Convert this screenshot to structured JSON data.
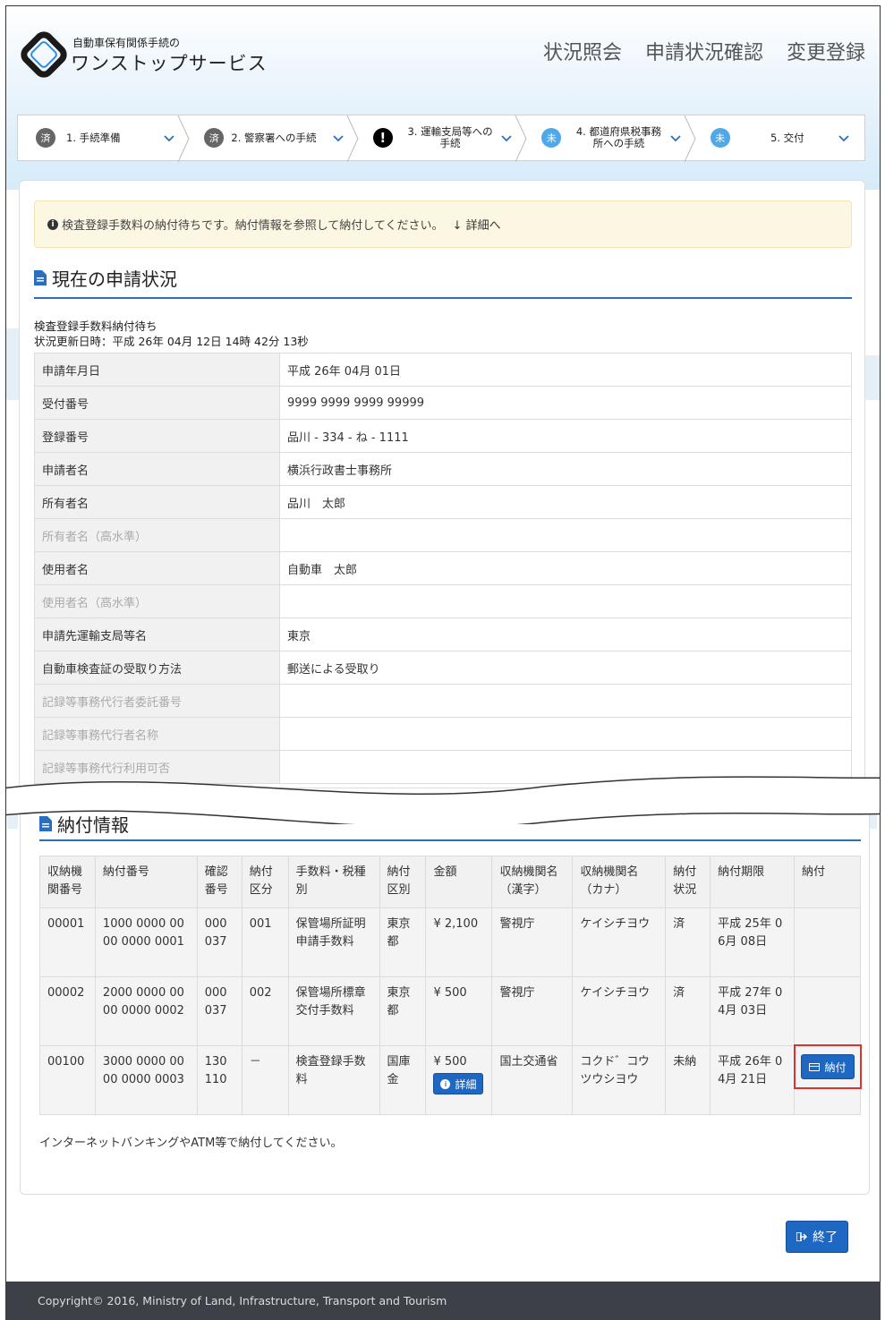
{
  "brand": {
    "small": "自動車保有関係手続の",
    "big": "ワンストップサービス"
  },
  "topnav": [
    "状況照会",
    "申請状況確認",
    "変更登録"
  ],
  "steps": [
    {
      "badge": "済",
      "label": "1. 手続準備"
    },
    {
      "badge": "済",
      "label": "2. 警察署への手続"
    },
    {
      "badge": "!",
      "label": "3. 運輸支局等への手続"
    },
    {
      "badge": "未",
      "label": "4. 都道府県税事務所への手続"
    },
    {
      "badge": "未",
      "label": "5. 交付"
    }
  ],
  "alert": {
    "message": "検査登録手数料の納付待ちです。納付情報を参照して納付してください。",
    "link": "詳細へ"
  },
  "status": {
    "title": "現在の申請状況",
    "line1": "検査登録手数料納付待ち",
    "line2": "状況更新日時：平成 26年 04月 12日 14時 42分 13秒"
  },
  "info_rows": [
    {
      "k": "申請年月日",
      "v": "平成 26年 04月 01日"
    },
    {
      "k": "受付番号",
      "v": "9999 9999 9999 99999"
    },
    {
      "k": "登録番号",
      "v": "品川 - 334 - ね - 1111"
    },
    {
      "k": "申請者名",
      "v": "横浜行政書士事務所"
    },
    {
      "k": "所有者名",
      "v": "品川　太郎"
    },
    {
      "k": "所有者名（高水準）",
      "v": ""
    },
    {
      "k": "使用者名",
      "v": "自動車　太郎"
    },
    {
      "k": "使用者名（高水準）",
      "v": ""
    },
    {
      "k": "申請先運輸支局等名",
      "v": "東京"
    },
    {
      "k": "自動車検査証の受取り方法",
      "v": "郵送による受取り"
    },
    {
      "k": "記録等事務代行者委託番号",
      "v": ""
    },
    {
      "k": "記録等事務代行者名称",
      "v": ""
    },
    {
      "k": "記録等事務代行利用可否",
      "v": ""
    }
  ],
  "payment": {
    "title": "納付情報",
    "headers": [
      "収納機関番号",
      "納付番号",
      "確認番号",
      "納付区分",
      "手数料・税種別",
      "納付区別",
      "金額",
      "収納機関名（漢字）",
      "収納機関名（カナ）",
      "納付状況",
      "納付期限",
      "納付"
    ],
    "rows": [
      [
        "00001",
        "1000 0000 0000 0000 0001",
        "000037",
        "001",
        "保管場所証明申請手数料",
        "東京都",
        "¥ 2,100",
        "警視庁",
        "ケイシチヨウ",
        "済",
        "平成 25年 06月 08日",
        ""
      ],
      [
        "00002",
        "2000 0000 0000 0000 0002",
        "000037",
        "002",
        "保管場所標章交付手数料",
        "東京都",
        "¥ 500",
        "警視庁",
        "ケイシチヨウ",
        "済",
        "平成 27年 04月 03日",
        ""
      ],
      [
        "00100",
        "3000 0000 0000 0000 0003",
        "130110",
        "－",
        "検査登録手数料",
        "国庫金",
        "¥ 500",
        "国土交通省",
        "コクド゛コウツウシヨウ",
        "未納",
        "平成 26年 04月 21日",
        ""
      ]
    ],
    "detail_button": "詳細",
    "pay_button": "納付",
    "note": "インターネットバンキングやATM等で納付してください。"
  },
  "end_button": "終了",
  "footer": "Copyright© 2016, Ministry of Land, Infrastructure, Transport and Tourism"
}
